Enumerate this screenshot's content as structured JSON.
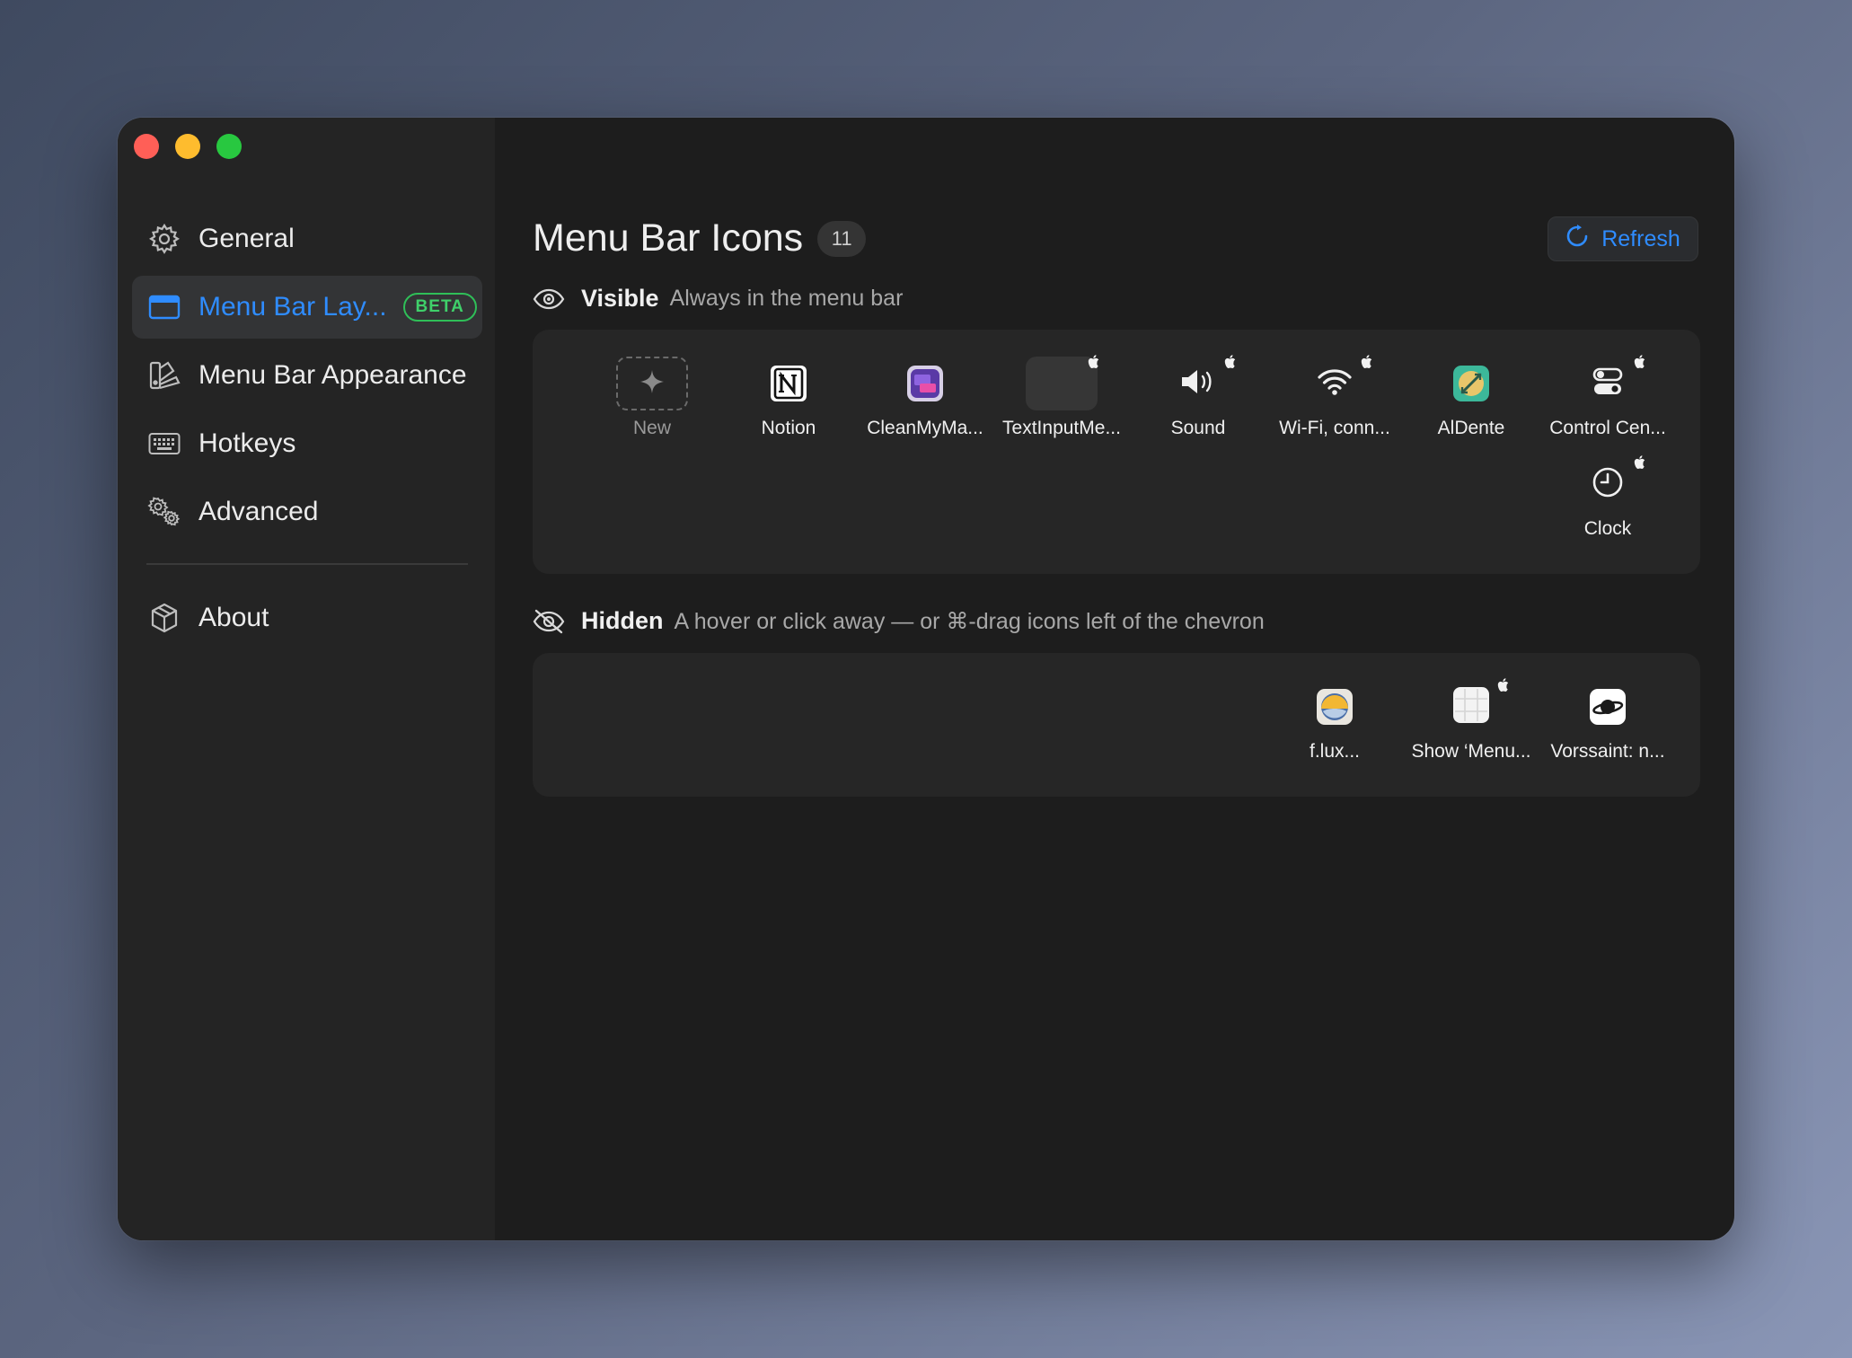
{
  "sidebar": {
    "items": [
      {
        "label": "General",
        "icon": "gear-icon"
      },
      {
        "label": "Menu Bar Lay...",
        "icon": "menu-bar-layout-icon",
        "badge": "BETA",
        "active": true
      },
      {
        "label": "Menu Bar Appearance",
        "icon": "palette-icon"
      },
      {
        "label": "Hotkeys",
        "icon": "keyboard-icon"
      },
      {
        "label": "Advanced",
        "icon": "gears-icon"
      },
      {
        "label": "About",
        "icon": "cube-icon"
      }
    ]
  },
  "header": {
    "title": "Menu Bar Icons",
    "count": "11",
    "refresh_label": "Refresh"
  },
  "visible": {
    "title": "Visible",
    "description": "Always in the menu bar",
    "items": [
      {
        "label": "New",
        "icon": "sparkle-icon"
      },
      {
        "label": "Notion",
        "icon": "notion-icon"
      },
      {
        "label": "CleanMyMa...",
        "icon": "cleanmymac-icon"
      },
      {
        "label": "TextInputMe...",
        "icon": "blank-icon",
        "system": true
      },
      {
        "label": "Sound",
        "icon": "speaker-icon",
        "system": true
      },
      {
        "label": "Wi-Fi, conn...",
        "icon": "wifi-icon",
        "system": true
      },
      {
        "label": "AlDente",
        "icon": "aldente-icon"
      },
      {
        "label": "Control Cen...",
        "icon": "control-center-icon",
        "system": true
      },
      {
        "label": "Clock",
        "icon": "clock-icon",
        "system": true
      }
    ]
  },
  "hidden": {
    "title": "Hidden",
    "description": "A hover or click away — or ⌘-drag icons left of the chevron",
    "items": [
      {
        "label": "f.lux...",
        "icon": "flux-icon"
      },
      {
        "label": "Show ‘Menu...",
        "icon": "grid-icon",
        "system": true
      },
      {
        "label": "Vorssaint: n...",
        "icon": "saturn-icon"
      }
    ]
  },
  "colors": {
    "accent": "#2f8cff",
    "beta_badge": "#2fbf58",
    "window_bg": "#1d1d1d",
    "sidebar_bg": "#242424",
    "panel_bg": "#262626"
  }
}
